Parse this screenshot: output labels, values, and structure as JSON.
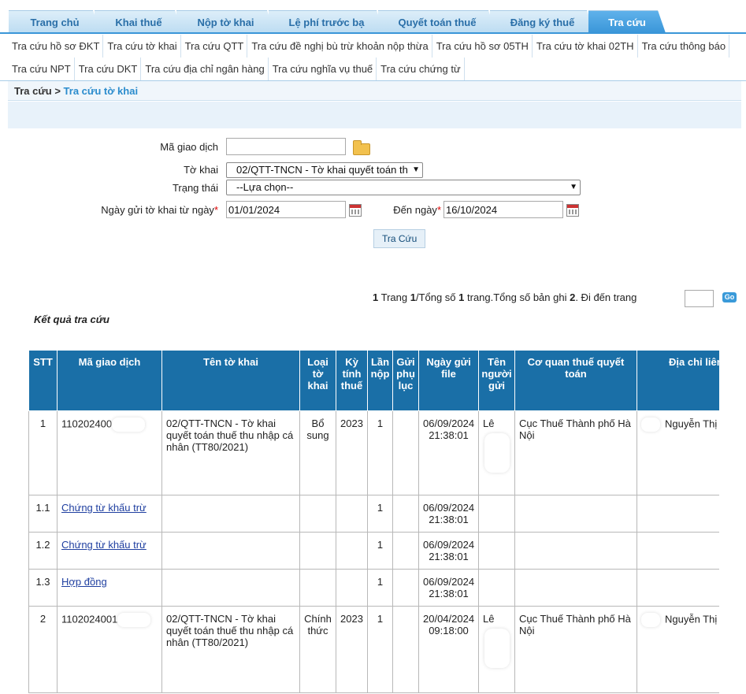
{
  "tabs": [
    {
      "label": "Trang chủ"
    },
    {
      "label": "Khai thuế"
    },
    {
      "label": "Nộp tờ khai"
    },
    {
      "label": "Lệ phí trước bạ"
    },
    {
      "label": "Quyết toán thuế"
    },
    {
      "label": "Đăng ký thuế"
    },
    {
      "label": "Tra cứu"
    }
  ],
  "submenu": {
    "row1": [
      "Tra cứu hồ sơ ĐKT",
      "Tra cứu tờ khai",
      "Tra cứu QTT",
      "Tra cứu đề nghị bù trừ khoản nộp thừa",
      "Tra cứu hồ sơ 05TH",
      "Tra cứu tờ khai 02TH",
      "Tra cứu thông báo"
    ],
    "row2": [
      "Tra cứu NPT",
      "Tra cứu DKT",
      "Tra cứu địa chỉ ngân hàng",
      "Tra cứu nghĩa vụ thuế",
      "Tra cứu chứng từ"
    ]
  },
  "breadcrumb": {
    "root": "Tra cứu",
    "sep": " > ",
    "current": "Tra cứu tờ khai"
  },
  "form": {
    "ma_gd_label": "Mã giao dịch",
    "ma_gd_value": "",
    "to_khai_label": "Tờ khai",
    "to_khai_value": "02/QTT-TNCN - Tờ khai quyết toán th",
    "trang_thai_label": "Trạng thái",
    "trang_thai_value": "--Lựa chọn--",
    "tu_ngay_label": "Ngày gửi tờ khai từ ngày",
    "tu_ngay_value": "01/01/2024",
    "den_ngay_label": "Đến ngày",
    "den_ngay_value": "16/10/2024",
    "required_mark": "*",
    "search_button": "Tra Cứu"
  },
  "pager": {
    "current_page": "1",
    "t1": "Trang ",
    "page": "1",
    "t2": "/Tổng số ",
    "total_pages": "1",
    "t3": " trang.Tổng số bản ghi ",
    "total_records": "2",
    "t4": ". Đi đến trang",
    "go": "Go"
  },
  "results_title": "Kết quả tra cứu",
  "table": {
    "headers": [
      "STT",
      "Mã giao dịch",
      "Tên tờ khai",
      "Loại tờ khai",
      "Kỳ tính thuế",
      "Lần nộp",
      "Gửi phụ lục",
      "Ngày gửi file",
      "Tên người gửi",
      "Cơ quan thuế quyết toán",
      "Địa chỉ liên"
    ],
    "rows": [
      {
        "stt": "1",
        "ma": "110202400",
        "ten": "02/QTT-TNCN - Tờ khai quyết toán thuế thu nhập cá nhân (TT80/2021)",
        "loai": "Bổ sung",
        "ky": "2023",
        "lan": "1",
        "phuluc": "",
        "ngay": "06/09/2024 21:38:01",
        "nguoi": "Lê",
        "cqt": "Cục Thuế Thành phố Hà Nội",
        "diachi": "Nguyễn Thị"
      },
      {
        "stt": "1.1",
        "link": "Chứng từ khấu trừ",
        "lan": "1",
        "ngay": "06/09/2024 21:38:01"
      },
      {
        "stt": "1.2",
        "link": "Chứng từ khấu trừ",
        "lan": "1",
        "ngay": "06/09/2024 21:38:01"
      },
      {
        "stt": "1.3",
        "link": "Hợp đồng",
        "lan": "1",
        "ngay": "06/09/2024 21:38:01"
      },
      {
        "stt": "2",
        "ma": "1102024001",
        "ten": "02/QTT-TNCN - Tờ khai quyết toán thuế thu nhập cá nhân (TT80/2021)",
        "loai": "Chính thức",
        "ky": "2023",
        "lan": "1",
        "phuluc": "",
        "ngay": "20/04/2024 09:18:00",
        "nguoi": "Lê",
        "cqt": "Cục Thuế Thành phố Hà Nội",
        "diachi": "Nguyễn Thị"
      }
    ]
  }
}
